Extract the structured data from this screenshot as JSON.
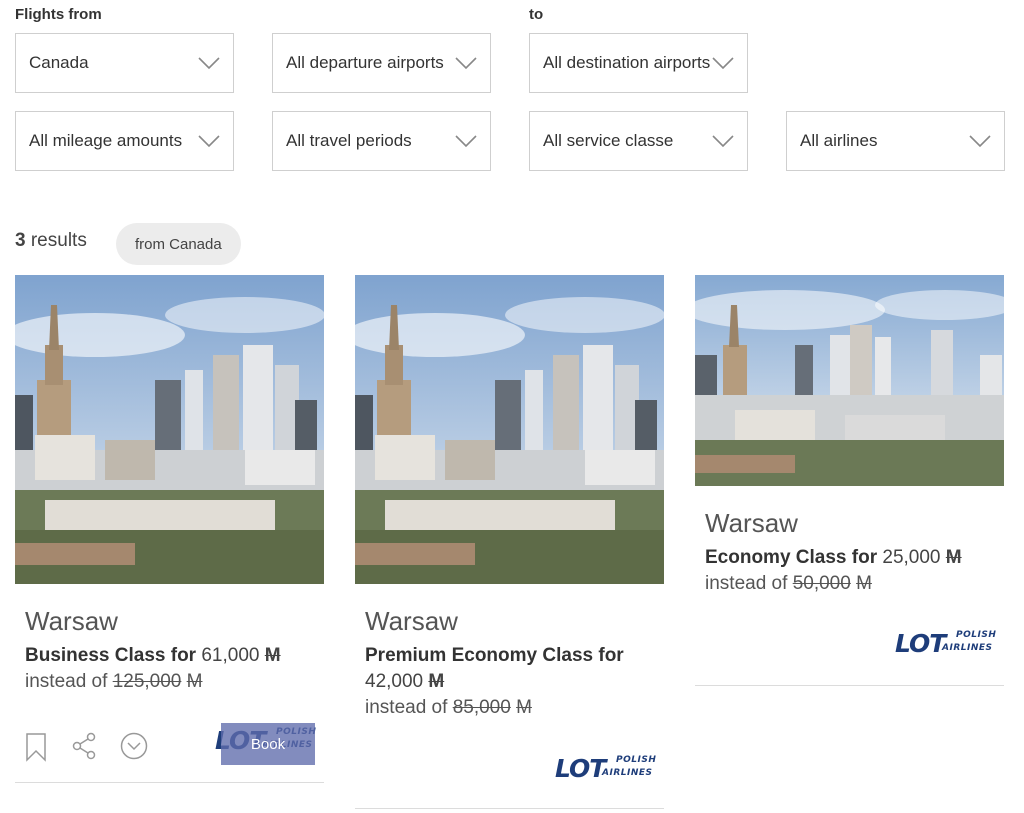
{
  "filters": {
    "from_label": "Flights from",
    "to_label": "to",
    "country": "Canada",
    "departure": "All departure airports",
    "destination": "All destination airports",
    "mileage": "All mileage amounts",
    "periods": "All travel periods",
    "service": "All service classe",
    "airlines": "All airlines"
  },
  "results": {
    "count": "3",
    "label": "results",
    "chip": "from Canada"
  },
  "cards": [
    {
      "city": "Warsaw",
      "class_label": "Business Class for",
      "miles": "61,000",
      "mile_symbol": "M",
      "instead_label": "instead of",
      "old_miles": "125,000",
      "book_label": "Book",
      "airline_logo": "LOT Polish Airlines"
    },
    {
      "city": "Warsaw",
      "class_label": "Premium Economy Class for",
      "miles": "42,000",
      "mile_symbol": "M",
      "instead_label": "instead of",
      "old_miles": "85,000",
      "airline_logo": "LOT Polish Airlines"
    },
    {
      "city": "Warsaw",
      "class_label": "Economy Class for",
      "miles": "25,000",
      "mile_symbol": "M",
      "instead_label": "instead of",
      "old_miles": "50,000",
      "airline_logo": "LOT Polish Airlines"
    }
  ],
  "logo": {
    "mark": "LOT",
    "line1": "POLISH",
    "line2": "AIRLINES"
  },
  "icons": {
    "bookmark": "bookmark-icon",
    "share": "share-icon",
    "expand": "chevron-circle-icon",
    "dropdown": "chevron-down-icon"
  },
  "colors": {
    "book_button": "#5f6cac",
    "lot_blue": "#1e3d7a",
    "chip_bg": "#ececec"
  }
}
